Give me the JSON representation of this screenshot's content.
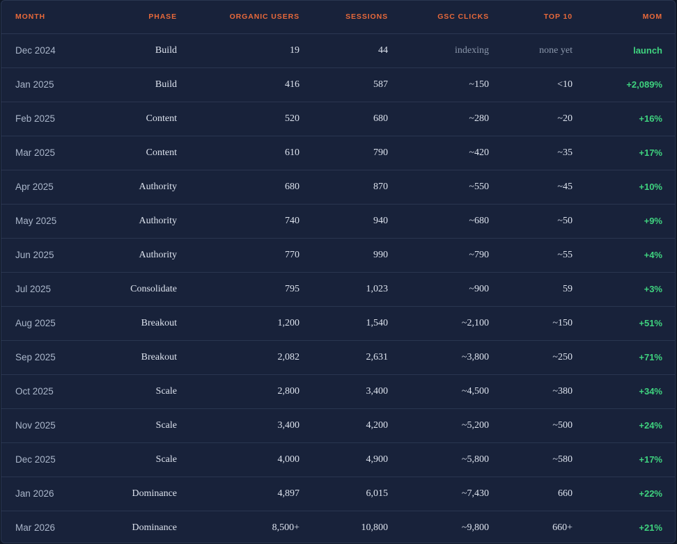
{
  "columns": [
    "Month",
    "Phase",
    "Organic Users",
    "Sessions",
    "GSC Clicks",
    "Top 10",
    "MoM"
  ],
  "colors": {
    "header_accent": "#e8693a",
    "positive": "#3fd37f",
    "background": "#18223a"
  },
  "rows": [
    {
      "month": "Dec 2024",
      "phase": "Build",
      "users": "19",
      "sessions": "44",
      "gsc": "indexing",
      "top10": "none yet",
      "mom": "launch"
    },
    {
      "month": "Jan 2025",
      "phase": "Build",
      "users": "416",
      "sessions": "587",
      "gsc": "~150",
      "top10": "<10",
      "mom": "+2,089%"
    },
    {
      "month": "Feb 2025",
      "phase": "Content",
      "users": "520",
      "sessions": "680",
      "gsc": "~280",
      "top10": "~20",
      "mom": "+16%"
    },
    {
      "month": "Mar 2025",
      "phase": "Content",
      "users": "610",
      "sessions": "790",
      "gsc": "~420",
      "top10": "~35",
      "mom": "+17%"
    },
    {
      "month": "Apr 2025",
      "phase": "Authority",
      "users": "680",
      "sessions": "870",
      "gsc": "~550",
      "top10": "~45",
      "mom": "+10%"
    },
    {
      "month": "May 2025",
      "phase": "Authority",
      "users": "740",
      "sessions": "940",
      "gsc": "~680",
      "top10": "~50",
      "mom": "+9%"
    },
    {
      "month": "Jun 2025",
      "phase": "Authority",
      "users": "770",
      "sessions": "990",
      "gsc": "~790",
      "top10": "~55",
      "mom": "+4%"
    },
    {
      "month": "Jul 2025",
      "phase": "Consolidate",
      "users": "795",
      "sessions": "1,023",
      "gsc": "~900",
      "top10": "59",
      "mom": "+3%"
    },
    {
      "month": "Aug 2025",
      "phase": "Breakout",
      "users": "1,200",
      "sessions": "1,540",
      "gsc": "~2,100",
      "top10": "~150",
      "mom": "+51%"
    },
    {
      "month": "Sep 2025",
      "phase": "Breakout",
      "users": "2,082",
      "sessions": "2,631",
      "gsc": "~3,800",
      "top10": "~250",
      "mom": "+71%"
    },
    {
      "month": "Oct 2025",
      "phase": "Scale",
      "users": "2,800",
      "sessions": "3,400",
      "gsc": "~4,500",
      "top10": "~380",
      "mom": "+34%"
    },
    {
      "month": "Nov 2025",
      "phase": "Scale",
      "users": "3,400",
      "sessions": "4,200",
      "gsc": "~5,200",
      "top10": "~500",
      "mom": "+24%"
    },
    {
      "month": "Dec 2025",
      "phase": "Scale",
      "users": "4,000",
      "sessions": "4,900",
      "gsc": "~5,800",
      "top10": "~580",
      "mom": "+17%"
    },
    {
      "month": "Jan 2026",
      "phase": "Dominance",
      "users": "4,897",
      "sessions": "6,015",
      "gsc": "~7,430",
      "top10": "660",
      "mom": "+22%"
    },
    {
      "month": "Mar 2026",
      "phase": "Dominance",
      "users": "8,500+",
      "sessions": "10,800",
      "gsc": "~9,800",
      "top10": "660+",
      "mom": "+21%"
    }
  ]
}
